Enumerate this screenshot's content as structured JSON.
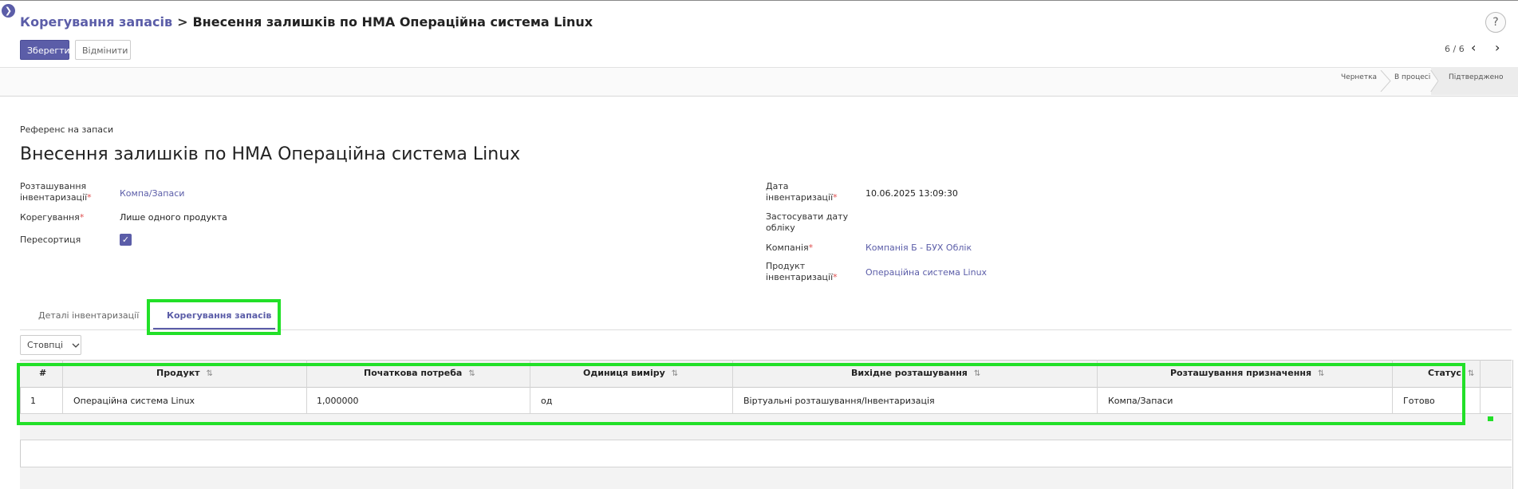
{
  "breadcrumb": {
    "parent": "Корегування запасів",
    "separator": ">",
    "current": "Внесення залишків по НМА Операційна система Linux"
  },
  "toolbar": {
    "save_label": "Зберегти",
    "discard_label": "Відмінити"
  },
  "pager": {
    "text": "6 / 6"
  },
  "help": {
    "label": "?"
  },
  "statusbar": {
    "stages": [
      "Чернетка",
      "В процесі",
      "Підтверджено"
    ],
    "active": "Підтверджено"
  },
  "form": {
    "ref_label": "Референс на запаси",
    "title": "Внесення залишків по НМА Операційна система Linux",
    "left": {
      "location_label_1": "Розташування",
      "location_label_2": "інвентаризації",
      "location_value": "Компа/Запаси",
      "adjustment_label": "Корегування",
      "adjustment_value": "Лише одного продукта",
      "resort_label": "Пересортиця",
      "resort_checked": true
    },
    "right": {
      "date_label_1": "Дата",
      "date_label_2": "інвентаризації",
      "date_value": "10.06.2025 13:09:30",
      "accounting_label_1": "Застосувати дату",
      "accounting_label_2": "обліку",
      "company_label": "Компанія",
      "company_value": "Компанія Б - БУХ Облік",
      "product_label_1": "Продукт",
      "product_label_2": "інвентаризації",
      "product_value": "Операційна система Linux"
    },
    "required_mark": "*"
  },
  "tabs": [
    {
      "label": "Деталі інвентаризації",
      "active": false
    },
    {
      "label": "Корегування запасів",
      "active": true
    }
  ],
  "table": {
    "columns_button": "Стовпці",
    "headers": [
      "#",
      "Продукт",
      "Початкова потреба",
      "Одиниця виміру",
      "Вихідне розташування",
      "Розташування призначення",
      "Статус"
    ],
    "rows": [
      [
        "1",
        "Операційна система Linux",
        "1,000000",
        "од",
        "Віртуальні розташування/Інвентаризація",
        "Компа/Запаси",
        "Готово"
      ]
    ]
  },
  "colors": {
    "accent": "#5b5da8",
    "highlight": "#22e028",
    "required": "#e05050"
  },
  "icons": [
    "chevron-right-icon",
    "help-icon",
    "chevron-left-icon",
    "checkmark-icon",
    "chevron-down-icon",
    "sort-icon"
  ]
}
